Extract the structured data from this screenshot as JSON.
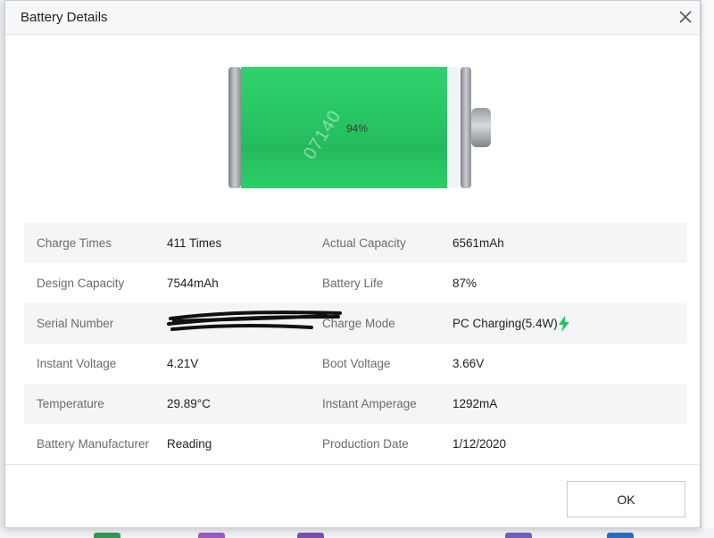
{
  "dialog": {
    "title": "Battery Details",
    "ok_label": "OK"
  },
  "battery": {
    "percent_text": "94%",
    "level": 0.94,
    "fill_color": "#22c55e",
    "watermark": "07140"
  },
  "details": {
    "rows": [
      {
        "l1": "Charge Times",
        "v1": "411 Times",
        "l2": "Actual Capacity",
        "v2": "6561mAh"
      },
      {
        "l1": "Design Capacity",
        "v1": "7544mAh",
        "l2": "Battery Life",
        "v2": "87%"
      },
      {
        "l1": "Serial Number",
        "v1": "",
        "l2": "Charge Mode",
        "v2": "PC Charging(5.4W)"
      },
      {
        "l1": "Instant Voltage",
        "v1": "4.21V",
        "l2": "Boot Voltage",
        "v2": "3.66V"
      },
      {
        "l1": "Temperature",
        "v1": "29.89°C",
        "l2": "Instant Amperage",
        "v2": "1292mA"
      },
      {
        "l1": "Battery Manufacturer",
        "v1": "Reading",
        "l2": "Production Date",
        "v2": "1/12/2020"
      }
    ]
  },
  "icons": {
    "close": "close-icon",
    "charging": "lightning-bolt-icon",
    "accent": "#22c55e"
  }
}
